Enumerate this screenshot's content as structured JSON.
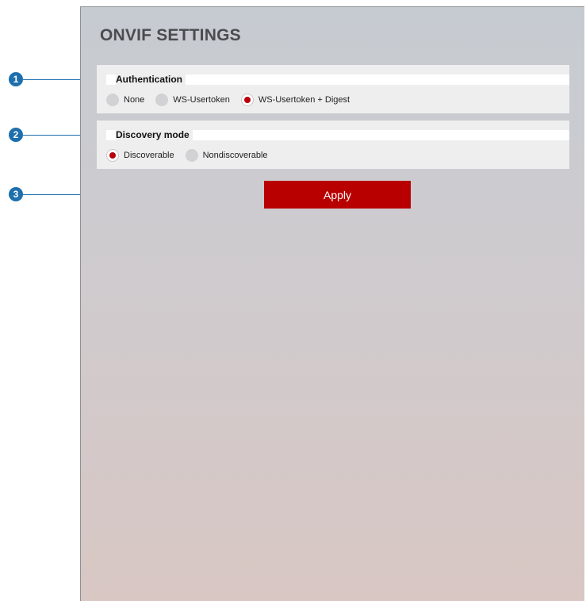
{
  "page": {
    "title": "ONVIF SETTINGS"
  },
  "authentication": {
    "label": "Authentication",
    "options": [
      {
        "label": "None",
        "selected": false
      },
      {
        "label": "WS-Usertoken",
        "selected": false
      },
      {
        "label": "WS-Usertoken + Digest",
        "selected": true
      }
    ]
  },
  "discovery": {
    "label": "Discovery mode",
    "options": [
      {
        "label": "Discoverable",
        "selected": true
      },
      {
        "label": "Nondiscoverable",
        "selected": false
      }
    ]
  },
  "actions": {
    "apply_label": "Apply"
  },
  "callouts": [
    "1",
    "2",
    "3"
  ],
  "colors": {
    "accent": "#b80000",
    "callout": "#1d6fad"
  }
}
